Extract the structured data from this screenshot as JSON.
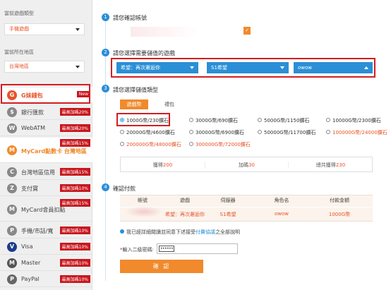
{
  "sidebar": {
    "game_type_label": "當前遊戲類型",
    "game_type_value": "手機遊戲",
    "region_label": "當前所在地區",
    "region_value": "台灣地區",
    "items": [
      {
        "icon": "G",
        "label": "G妹錢包",
        "badge": "New"
      },
      {
        "icon": "$",
        "label": "銀行匯款",
        "badge": "最高加碼20%"
      },
      {
        "icon": "W",
        "label": "WebATM",
        "badge": "最高加碼20%"
      },
      {
        "icon": "M",
        "label": "MyCard點數卡 台灣地區",
        "badge": "最高加碼15%"
      },
      {
        "icon": "C",
        "label": "台灣地區信用",
        "badge": "最高加碼15%"
      },
      {
        "icon": "Z",
        "label": "支付寶",
        "badge": "最高加碼10%"
      },
      {
        "icon": "M",
        "label": "MyCard會員扣點",
        "badge": "最高加碼15%"
      },
      {
        "icon": "P",
        "label": "手機/市話/寬",
        "badge": "最高加碼10%"
      },
      {
        "icon": "V",
        "label": "Visa",
        "badge": "最高加碼10%"
      },
      {
        "icon": "M",
        "label": "Master",
        "badge": "最高加碼10%"
      },
      {
        "icon": "P",
        "label": "PayPal",
        "badge": "最高加碼10%"
      }
    ]
  },
  "steps": {
    "s1": {
      "num": "1",
      "title": "請您確認帳號",
      "check": "✓"
    },
    "s2": {
      "num": "2",
      "title": "請您選擇需要儲值的遊戲",
      "game": "希望：再次邂逅你",
      "server": "S1希望",
      "role": "owow"
    },
    "s3": {
      "num": "3",
      "title": "請您選擇儲值類型",
      "tab_active": "遊戲幣",
      "tab_other": "禮包",
      "options": [
        {
          "text": "1000G幣/230鑽石",
          "selected": true,
          "red": false
        },
        {
          "text": "3000G幣/690鑽石",
          "selected": false,
          "red": false
        },
        {
          "text": "5000G幣/1150鑽石",
          "selected": false,
          "red": false
        },
        {
          "text": "10000G幣/2300鑽石",
          "selected": false,
          "red": false
        },
        {
          "text": "20000G幣/4600鑽石",
          "selected": false,
          "red": false
        },
        {
          "text": "30000G幣/6900鑽石",
          "selected": false,
          "red": false
        },
        {
          "text": "50000G幣/11700鑽石",
          "selected": false,
          "red": false
        },
        {
          "text": "100000G幣/24000鑽石",
          "selected": false,
          "red": true
        },
        {
          "text": "200000G幣/48000鑽石",
          "selected": false,
          "red": true
        },
        {
          "text": "300000G幣/72000鑽石",
          "selected": false,
          "red": true
        }
      ],
      "summary": [
        {
          "label": "獲得",
          "value": "200"
        },
        {
          "label": "加碼",
          "value": "30"
        },
        {
          "label": "總共獲得",
          "value": "230"
        }
      ]
    },
    "s4": {
      "num": "4",
      "title": "確認付款",
      "headers": [
        "帳號",
        "遊戲",
        "伺服器",
        "角色名",
        "付款金額"
      ],
      "row": [
        "",
        "希望：再次邂逅你",
        "S1希望",
        "owow",
        "1000G幣"
      ],
      "agree_text": "我已經詳細閱讀並同意下述接受",
      "agree_link": "付費協議",
      "agree_suffix": "之全部說明",
      "pw_star": "*",
      "pw_label": "輸入二級密碼:",
      "pw_value": "••••••",
      "confirm": "確 認"
    }
  },
  "colors": {
    "accent": "#f08a2c",
    "blue": "#2a8fd6",
    "red": "#d31d23"
  }
}
